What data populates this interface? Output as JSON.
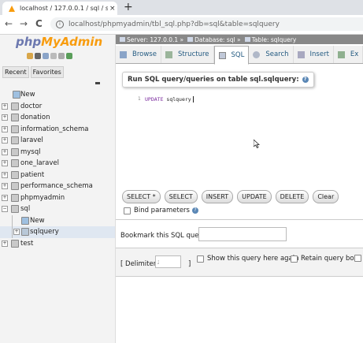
{
  "browser": {
    "tab_title": "localhost / 127.0.0.1 / sql / sqlqu",
    "tab_close": "×",
    "new_tab": "+",
    "back": "←",
    "forward": "→",
    "reload": "C",
    "url": "localhost/phpmyadmin/tbl_sql.php?db=sql&table=sqlquery",
    "info": "i"
  },
  "sidebar": {
    "logo_php": "php",
    "logo_myadmin": "MyAdmin",
    "tabs": [
      "Recent",
      "Favorites"
    ],
    "tree": [
      {
        "label": "New"
      },
      {
        "label": "doctor"
      },
      {
        "label": "donation"
      },
      {
        "label": "information_schema"
      },
      {
        "label": "laravel"
      },
      {
        "label": "mysql"
      },
      {
        "label": "one_laravel"
      },
      {
        "label": "patient"
      },
      {
        "label": "performance_schema"
      },
      {
        "label": "phpmyadmin"
      },
      {
        "label": "sql"
      },
      {
        "label": "New"
      },
      {
        "label": "sqlquery"
      },
      {
        "label": "test"
      }
    ]
  },
  "breadcrumb": {
    "server": "Server: 127.0.0.1 »",
    "database": "Database: sql »",
    "table": "Table: sqlquery"
  },
  "menu": {
    "tabs": [
      "Browse",
      "Structure",
      "SQL",
      "Search",
      "Insert",
      "Ex"
    ]
  },
  "sql_panel": {
    "legend": "Run SQL query/queries on table sql.sqlquery:",
    "help": "?",
    "line_number": "1",
    "keyword": "UPDATE",
    "table_name": "sqlquery",
    "buttons": [
      "SELECT *",
      "SELECT",
      "INSERT",
      "UPDATE",
      "DELETE",
      "Clear"
    ],
    "bind_parameters": "Bind parameters"
  },
  "bookmark": {
    "label": "Bookmark this SQL query:"
  },
  "options": {
    "delimiter_label": "[ Delimiter",
    "delimiter_value": ";",
    "delimiter_close": "]",
    "show_query": "Show this query here again",
    "retain_query": "Retain query box"
  },
  "colors": {
    "logo_php": "#6c78af",
    "logo_myadmin": "#f89c0e",
    "link_blue": "#235a81",
    "breadcrumb_bg": "#888888"
  }
}
